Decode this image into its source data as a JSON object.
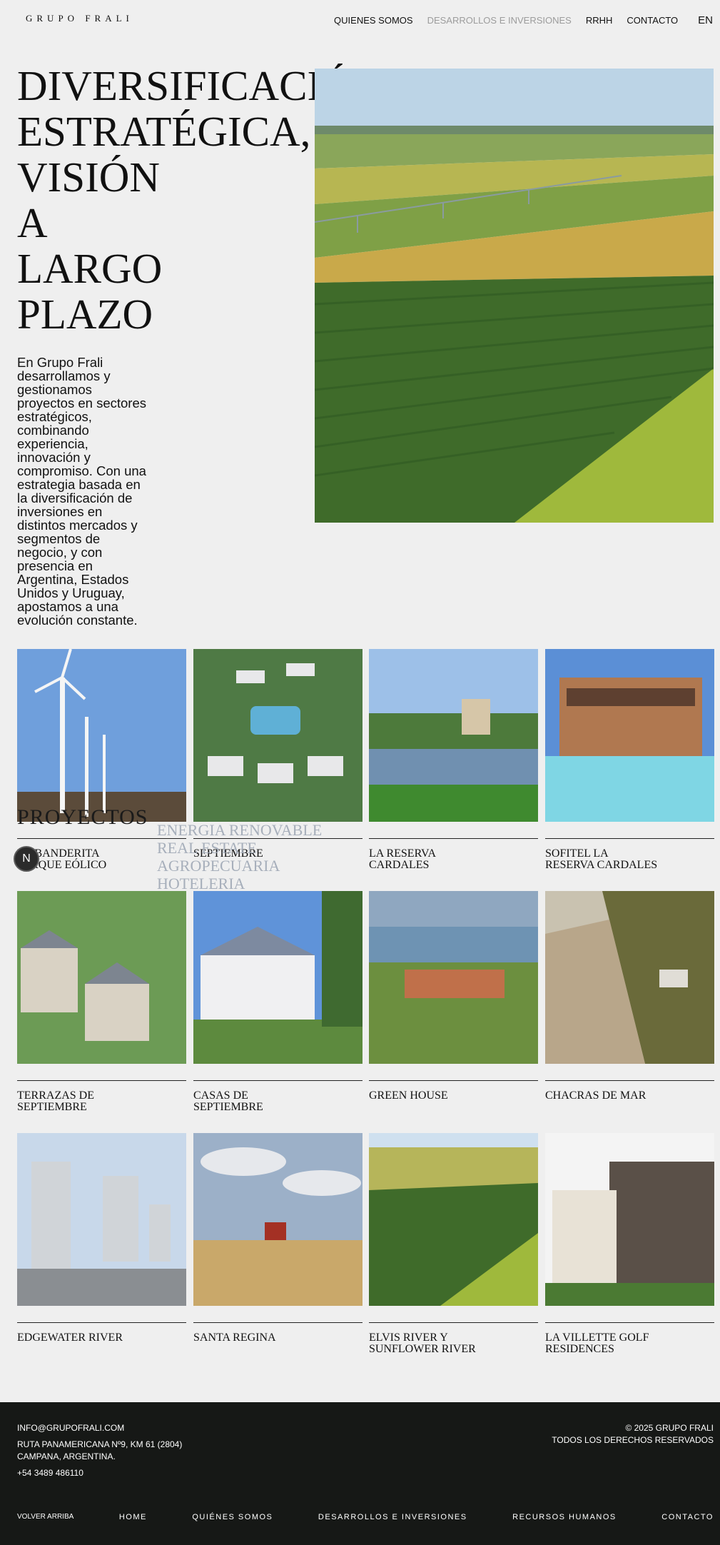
{
  "header": {
    "logo": "GRUPO FRALI",
    "nav": [
      {
        "label": "QUIENES SOMOS",
        "active": false
      },
      {
        "label": "DESARROLLOS E INVERSIONES",
        "active": true
      },
      {
        "label": "RRHH",
        "active": false
      },
      {
        "label": "CONTACTO",
        "active": false
      }
    ],
    "lang": "EN"
  },
  "hero": {
    "title_lines": [
      "DIVERSIFICACIÓN",
      "ESTRATÉGICA,",
      "VISIÓN",
      "A",
      "LARGO",
      "PLAZO"
    ],
    "text": "En Grupo Frali desarrollamos y gestionamos proyectos en sectores estratégicos, combinando experiencia, innovación y compromiso. Con una estrategia basada en la diversificación de inversiones en distintos mercados y segmentos de negocio, y con presencia en Argentina, Estados Unidos y Uruguay, apostamos a una evolución constante."
  },
  "projects": {
    "label": "PROYECTOS",
    "filters": [
      "ENERGIA RENOVABLE",
      "REAL ESTATE",
      "AGROPECUARIA",
      "HOTELERIA"
    ],
    "badge": "N",
    "items": [
      {
        "name_lines": [
          "LA BANDERITA",
          "PARQUE EÓLICO"
        ],
        "icon": "wind-turbines"
      },
      {
        "name_lines": [
          "SEPTIEMBRE"
        ],
        "icon": "aerial-neighborhood"
      },
      {
        "name_lines": [
          "LA RESERVA",
          "CARDALES"
        ],
        "icon": "lake-houses"
      },
      {
        "name_lines": [
          "SOFITEL LA",
          "RESERVA CARDALES"
        ],
        "icon": "hotel-pool"
      },
      {
        "name_lines": [
          "TERRAZAS DE",
          "SEPTIEMBRE"
        ],
        "icon": "townhouses"
      },
      {
        "name_lines": [
          "CASAS DE",
          "SEPTIEMBRE"
        ],
        "icon": "white-house"
      },
      {
        "name_lines": [
          "GREEN HOUSE"
        ],
        "icon": "tennis-courts"
      },
      {
        "name_lines": [
          "CHACRAS DE MAR"
        ],
        "icon": "dunes"
      },
      {
        "name_lines": [
          "EDGEWATER RIVER"
        ],
        "icon": "towers"
      },
      {
        "name_lines": [
          "SANTA REGINA"
        ],
        "icon": "harvester"
      },
      {
        "name_lines": [
          "ELVIS RIVER Y",
          "SUNFLOWER RIVER"
        ],
        "icon": "crop-fields"
      },
      {
        "name_lines": [
          "LA VILLETTE GOLF",
          "RESIDENCES"
        ],
        "icon": "stone-residence"
      }
    ]
  },
  "footer": {
    "email": "INFO@GRUPOFRALI.COM",
    "address_1": "RUTA PANAMERICANA Nº9, KM 61 (2804)",
    "address_2": "CAMPANA, ARGENTINA.",
    "phone": "+54 3489 486110",
    "copyright": "© 2025 GRUPO FRALI",
    "rights": "TODOS LOS DERECHOS RESERVADOS",
    "nav": [
      "VOLVER ARRIBA",
      "HOME",
      "QUIÉNES SOMOS",
      "DESARROLLOS E INVERSIONES",
      "RECURSOS HUMANOS",
      "CONTACTO"
    ]
  },
  "colors": {
    "background": "#efefef",
    "footer": "#161816",
    "active_nav": "#9c9c9c",
    "filters": "#a7afbb"
  }
}
